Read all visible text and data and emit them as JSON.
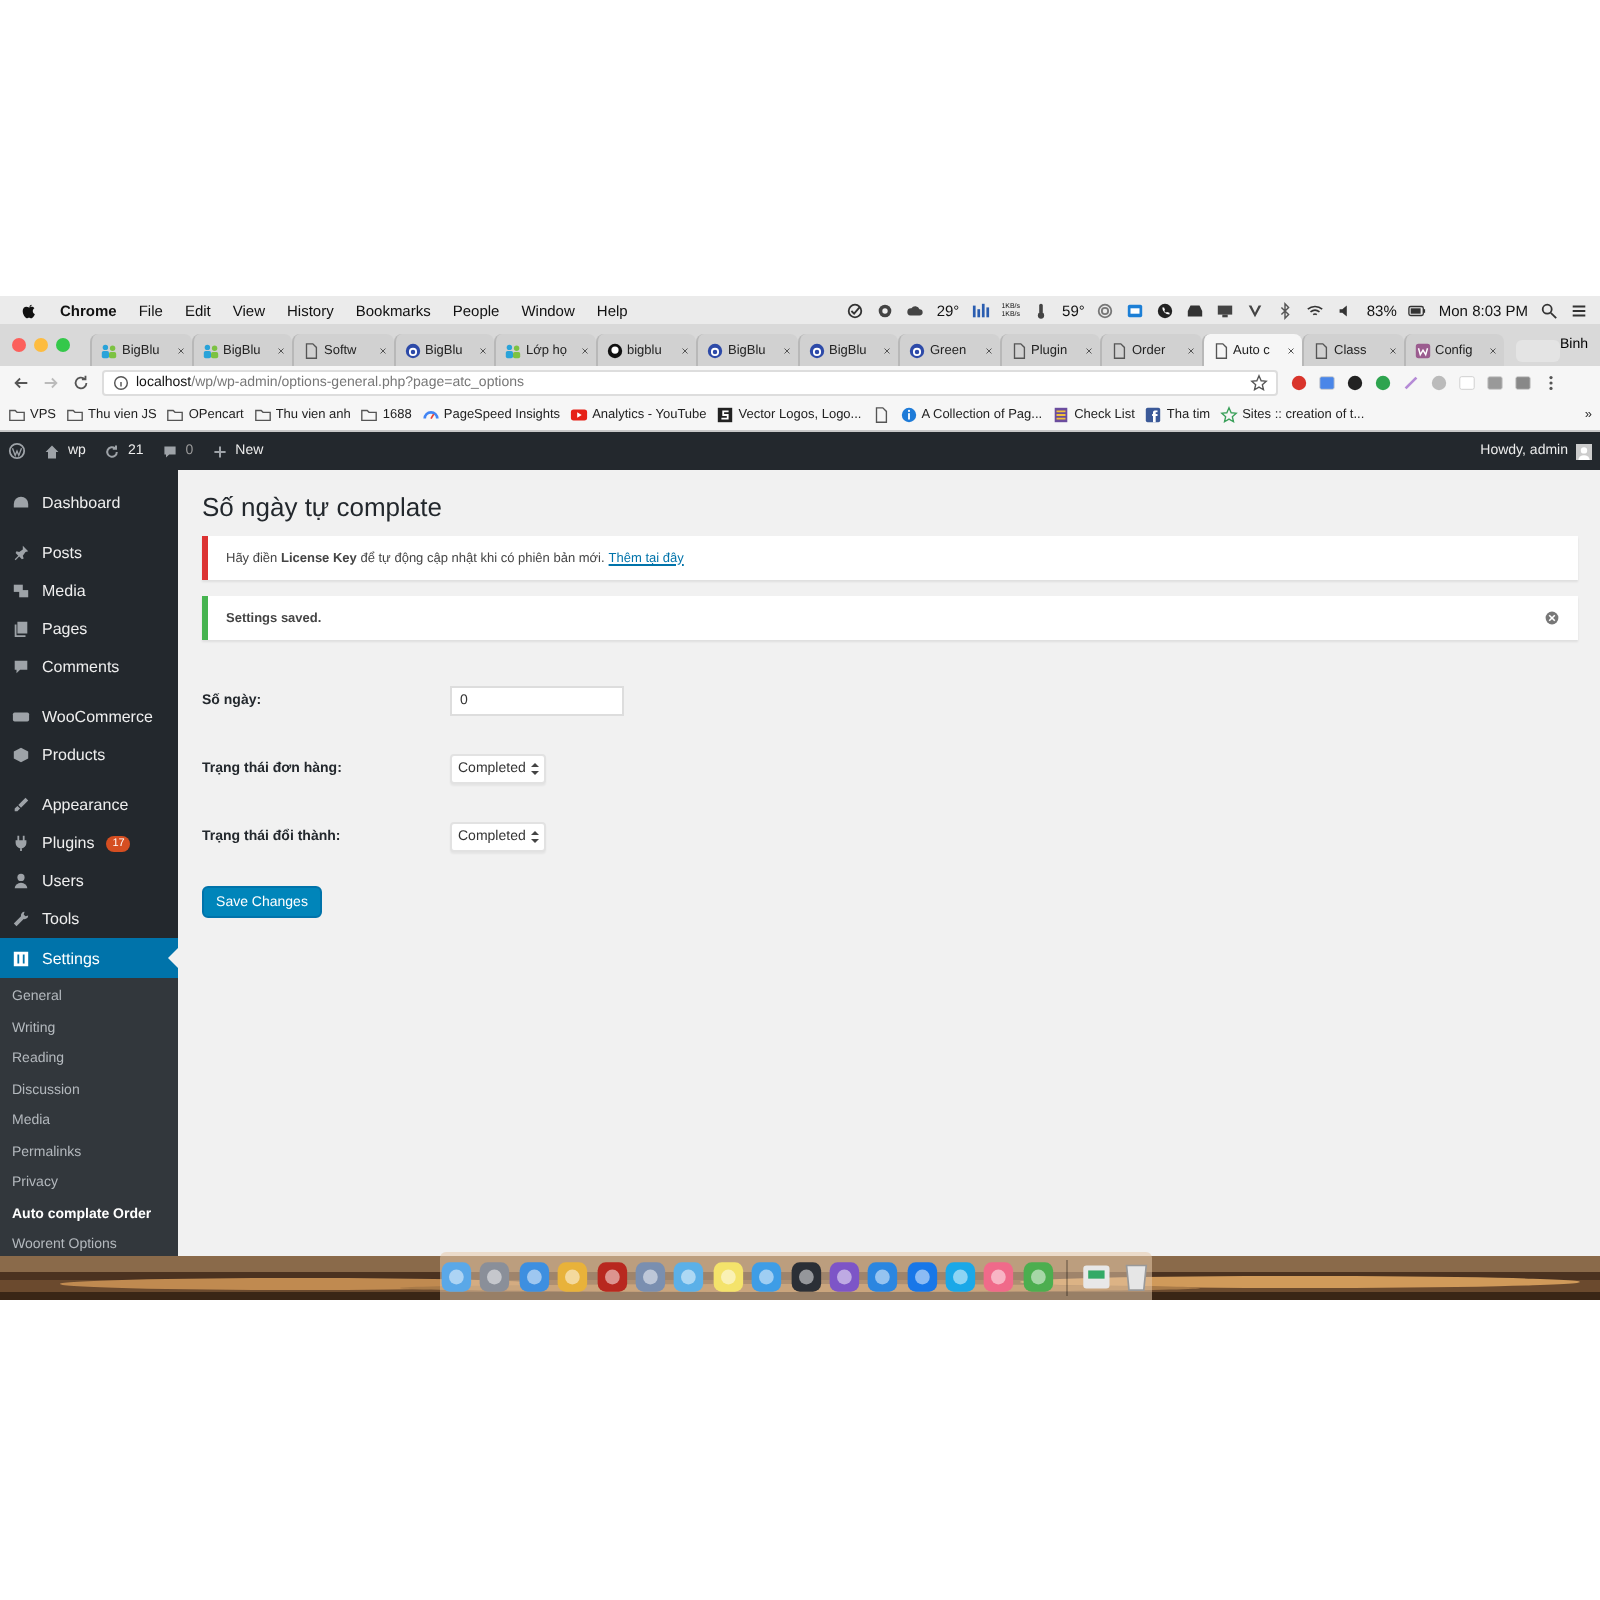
{
  "menu_bar": {
    "app": "Chrome",
    "menus": [
      "File",
      "Edit",
      "View",
      "History",
      "Bookmarks",
      "People",
      "Window",
      "Help"
    ],
    "status": [
      {
        "kind": "text",
        "text": "29°"
      },
      {
        "kind": "stack",
        "lines": [
          "1KB/s",
          "1KB/s"
        ]
      },
      {
        "kind": "text",
        "text": "59°"
      },
      {
        "kind": "text",
        "text": "83%"
      },
      {
        "kind": "text",
        "text": "Mon 8:03 PM"
      }
    ]
  },
  "tabs": [
    {
      "title": "BigBlu",
      "selected": false
    },
    {
      "title": "BigBlu",
      "selected": false
    },
    {
      "title": "Softw",
      "selected": false
    },
    {
      "title": "BigBlu",
      "selected": false
    },
    {
      "title": "Lớp họ",
      "selected": false
    },
    {
      "title": "bigblu",
      "selected": false
    },
    {
      "title": "BigBlu",
      "selected": false
    },
    {
      "title": "BigBlu",
      "selected": false
    },
    {
      "title": "Green",
      "selected": false
    },
    {
      "title": "Plugin",
      "selected": false
    },
    {
      "title": "Order",
      "selected": false
    },
    {
      "title": "Auto c",
      "selected": true
    },
    {
      "title": "Class",
      "selected": false
    },
    {
      "title": "Config",
      "selected": false
    }
  ],
  "profile": "Binh",
  "address": {
    "host": "localhost",
    "path": "/wp/wp-admin/options-general.php?page=atc_options"
  },
  "bookmarks": [
    "VPS",
    "Thu vien JS",
    "OPencart",
    "Thu vien anh",
    "1688",
    "PageSpeed Insights",
    "Analytics - YouTube",
    "Vector Logos, Logo...",
    "A Collection of Pag...",
    "Check List",
    "Tha tim",
    "Sites :: creation of t..."
  ],
  "bookmarks_more": "»",
  "admin_bar": {
    "site": "wp",
    "updates": "21",
    "comments": "0",
    "new": "New",
    "greeting": "Howdy, admin"
  },
  "sidebar": {
    "items": [
      {
        "label": "Dashboard",
        "selected": false
      },
      {
        "label": "Posts",
        "selected": false
      },
      {
        "label": "Media",
        "selected": false
      },
      {
        "label": "Pages",
        "selected": false
      },
      {
        "label": "Comments",
        "selected": false
      },
      {
        "label": "WooCommerce",
        "selected": false
      },
      {
        "label": "Products",
        "selected": false
      },
      {
        "label": "Appearance",
        "selected": false
      },
      {
        "label": "Plugins",
        "selected": false,
        "badge": "17"
      },
      {
        "label": "Users",
        "selected": false
      },
      {
        "label": "Tools",
        "selected": false
      },
      {
        "label": "Settings",
        "selected": true
      }
    ],
    "submenu": [
      {
        "label": "General",
        "selected": false
      },
      {
        "label": "Writing",
        "selected": false
      },
      {
        "label": "Reading",
        "selected": false
      },
      {
        "label": "Discussion",
        "selected": false
      },
      {
        "label": "Media",
        "selected": false
      },
      {
        "label": "Permalinks",
        "selected": false
      },
      {
        "label": "Privacy",
        "selected": false
      },
      {
        "label": "Auto complate Order",
        "selected": true
      },
      {
        "label": "Woorent Options",
        "selected": false
      }
    ]
  },
  "page": {
    "title": "Số ngày tự complate",
    "notices": [
      {
        "kind": "error",
        "text": "Hãy điền **License Key** để tự động cập nhật khi có phiên bản mới.",
        "link": "Thêm tại đây"
      },
      {
        "kind": "success",
        "text": "Settings saved.",
        "dismissible": true
      }
    ],
    "fields": [
      {
        "label": "Số ngày:",
        "kind": "text",
        "value": "0"
      },
      {
        "label": "Trạng thái đơn hàng:",
        "kind": "select",
        "value": "Completed"
      },
      {
        "label": "Trạng thái đổi thành:",
        "kind": "select",
        "value": "Completed"
      }
    ],
    "submit": "Save Changes"
  }
}
